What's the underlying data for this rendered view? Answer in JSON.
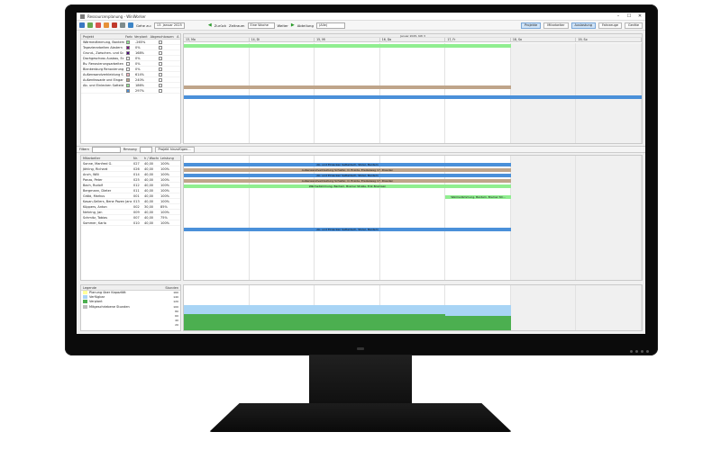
{
  "window": {
    "title": "Ressourcenplanung - WinWorker",
    "controls": [
      "–",
      "☐",
      "✕"
    ]
  },
  "toolbar": {
    "goto_label": "Gehe zu:",
    "date_value": "13. Januar 2025",
    "back_label": "Zurück",
    "range_label": "Zeitraum",
    "range_value": "Eine Woche",
    "next_label": "Weiter",
    "dept_label": "Abteilung",
    "dept_value": "(Alle)",
    "projects_label": "Projekte",
    "employees_label": "Mitarbeiter",
    "utilization_label": "Auslastung",
    "vehicles_label": "Fahrzeuge",
    "equipment_label": "Geräte"
  },
  "projects": {
    "headers": [
      "Projekt",
      "Farbe",
      "Verplant",
      "Abgeschlossen",
      "A"
    ],
    "rows": [
      {
        "name": "Wärmedämmung, Bantem",
        "color": "#90ee90",
        "planned": "-265%"
      },
      {
        "name": "Tapezierarbeiten Abstern",
        "color": "#800080",
        "planned": "0%"
      },
      {
        "name": "Grund-, Zwischen- und Sc",
        "color": "#4b0082",
        "planned": "168%"
      },
      {
        "name": "Dachgeschoss Ausbau, Ec",
        "color": "#ffffff",
        "planned": "0%"
      },
      {
        "name": "Bv. Renovierungsarbeiten",
        "color": "#ffffff",
        "planned": "0%"
      },
      {
        "name": "Blankenburg Renovierung",
        "color": "#ffffff",
        "planned": "0%"
      },
      {
        "name": "Außenwandverkleidung S",
        "color": "#ffb6c1",
        "planned": "614%"
      },
      {
        "name": "Außenfassade und Eingar",
        "color": "#bfa58a",
        "planned": "240%"
      },
      {
        "name": "Ab- und Einlecken Satteld",
        "color": "#90ee90",
        "planned": "186%"
      },
      {
        "name": "",
        "color": "#4a90d9",
        "planned": "297%"
      }
    ]
  },
  "calendar": {
    "week_label": "Januar 2025, KW 3",
    "days": [
      "13, Mo",
      "14, Di",
      "15, Mi",
      "16, Do",
      "17, Fr",
      "18, Sa",
      "19, So"
    ]
  },
  "filter": {
    "filter_label": "Filtern",
    "number_label": "Rmnung",
    "add_button": "Projekt hinzufügen..."
  },
  "employees": {
    "headers": [
      "Mitarbeiter",
      "Nr.",
      "h / Woche",
      "Leistung"
    ],
    "rows": [
      {
        "name": "Sonne, Manfred G.",
        "nr": "027",
        "hours": "40,00",
        "perf": "100%"
      },
      {
        "name": "Jöhling, Richard",
        "nr": "026",
        "hours": "40,00",
        "perf": "100%"
      },
      {
        "name": "Anch, Willi",
        "nr": "014",
        "hours": "40,00",
        "perf": "100%"
      },
      {
        "name": "Panzo, Peter",
        "nr": "025",
        "hours": "40,00",
        "perf": "100%"
      },
      {
        "name": "Bach, Rudolf",
        "nr": "012",
        "hours": "40,00",
        "perf": "100%"
      },
      {
        "name": "Bergmann, Dieter",
        "nr": "011",
        "hours": "40,00",
        "perf": "100%"
      },
      {
        "name": "Gröbi, Markus",
        "nr": "001",
        "hours": "40,00",
        "perf": "100%"
      },
      {
        "name": "Kasan-Sellers, Bene Pazen Jansen",
        "nr": "013",
        "hours": "40,00",
        "perf": "100%"
      },
      {
        "name": "Küppers, Anton",
        "nr": "002",
        "hours": "30,00",
        "perf": "85%"
      },
      {
        "name": "Nehring, Jan",
        "nr": "009",
        "hours": "40,00",
        "perf": "100%"
      },
      {
        "name": "Schmitz, Tobias",
        "nr": "007",
        "hours": "40,00",
        "perf": "75%"
      },
      {
        "name": "Sommer, Karla",
        "nr": "010",
        "hours": "40,00",
        "perf": "100%"
      }
    ]
  },
  "assignments": [
    {
      "text": "Ab- und Einlecken Satteldach, Stoler, Bantem",
      "color": "#4a90d9"
    },
    {
      "text": "Außenwandverkleidung Schiefer, O. Ereide, Ereizelweg 17, Dresden",
      "color": "#bfa58a"
    },
    {
      "text": "Ab- und Einlecken Satteldach, Stoler, Bantem",
      "color": "#4a90d9"
    },
    {
      "text": "Außenwandverkleidung Schiefer, O. Ereide, Ereizelweg 17, Dresden",
      "color": "#bfa58a"
    },
    {
      "text": "Wärmedämmung, Bantem, Bremer Straße, Erik Bosmsen",
      "color": "#90ee90"
    },
    {
      "text": "Wärmedämmung, Bantem, Bremer Str...",
      "color": "#90ee90"
    },
    {
      "text": "Ab- und Einlecken Satteldach, Stoler, Bantem",
      "color": "#4a90d9"
    }
  ],
  "legend": {
    "title": "Legende",
    "hours_label": "Stunden",
    "items": [
      {
        "label": "Planung über Kapazität",
        "color": "#ffff99"
      },
      {
        "label": "Verfügbar",
        "color": "#a8d4f5"
      },
      {
        "label": "Verplant",
        "color": "#4caf50"
      },
      {
        "label": "Mitgeschriebene Stunden",
        "color": "#bbbbbb"
      }
    ],
    "scale": [
      "160",
      "140",
      "120",
      "100",
      "80",
      "60",
      "40",
      "20"
    ]
  }
}
